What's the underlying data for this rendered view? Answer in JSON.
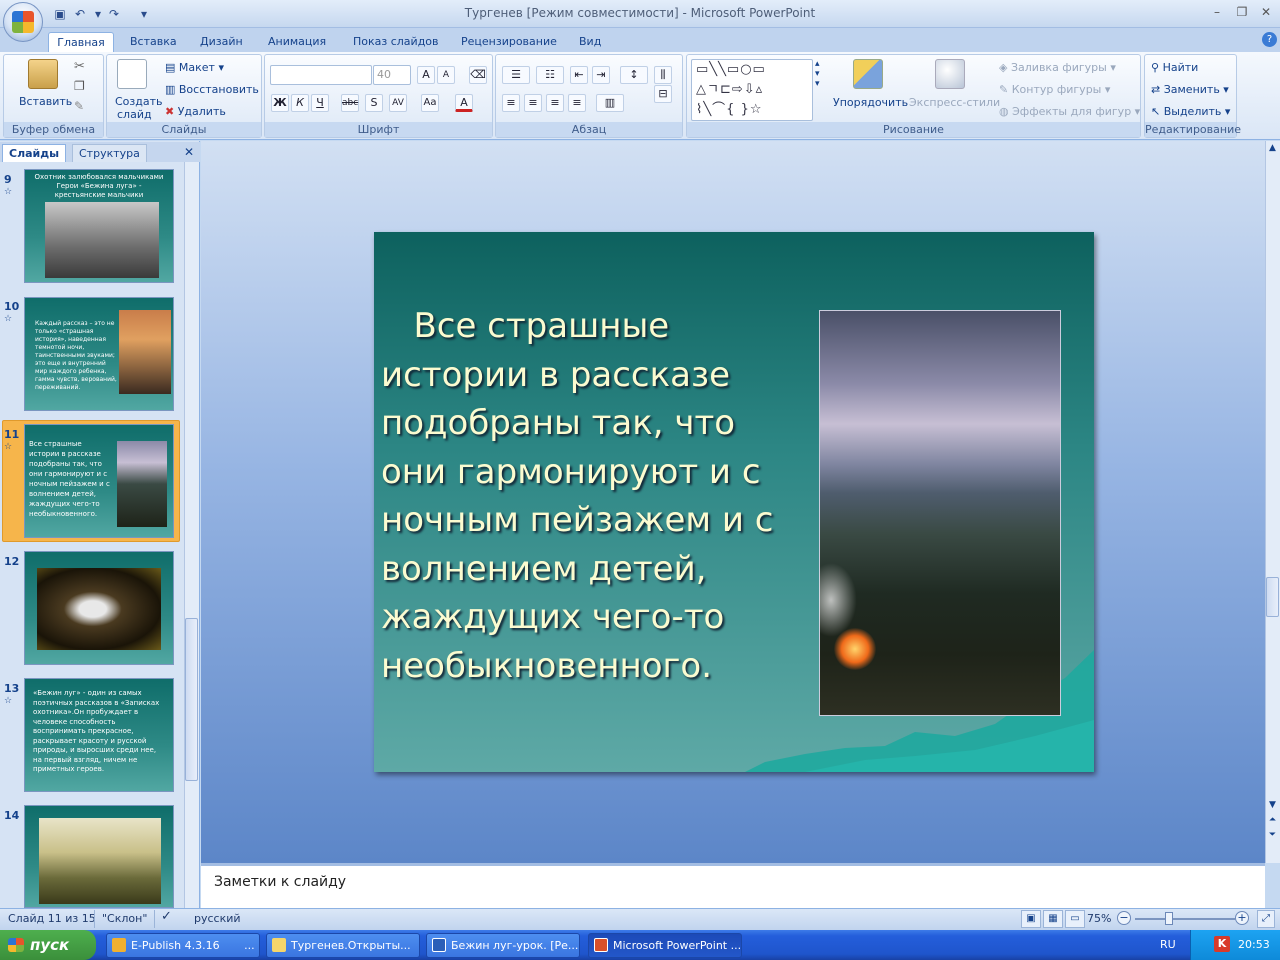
{
  "window": {
    "title": "Тургенев [Режим совместимости] - Microsoft PowerPoint"
  },
  "ribbon": {
    "tabs": [
      "Главная",
      "Вставка",
      "Дизайн",
      "Анимация",
      "Показ слайдов",
      "Рецензирование",
      "Вид"
    ],
    "groups": {
      "clipboard": {
        "label": "Буфер обмена",
        "paste": "Вставить"
      },
      "slides": {
        "label": "Слайды",
        "new_slide_1": "Создать",
        "new_slide_2": "слайд",
        "layout": "Макет",
        "reset": "Восстановить",
        "delete": "Удалить"
      },
      "font": {
        "label": "Шрифт",
        "font_name": "",
        "font_size": "40"
      },
      "paragraph": {
        "label": "Абзац"
      },
      "drawing": {
        "label": "Рисование",
        "arrange": "Упорядочить",
        "quick_styles": "Экспресс-стили",
        "shape_fill": "Заливка фигуры",
        "shape_outline": "Контур фигуры",
        "shape_effects": "Эффекты для фигур"
      },
      "editing": {
        "label": "Редактирование",
        "find": "Найти",
        "replace": "Заменить",
        "select": "Выделить"
      }
    }
  },
  "panel": {
    "tab_slides": "Слайды",
    "tab_outline": "Структура",
    "slides": [
      {
        "num": "9",
        "text": "Охотник залюбовался мальчиками Герои «Бежина луга» - крестьянские мальчики"
      },
      {
        "num": "10",
        "text": "Каждый рассказ – это не только «страшная история», наведенная темнотой ночи, таинственными звуками; это еще и внутренний мир каждого ребенка, гамма чувств, верований, переживаний."
      },
      {
        "num": "11",
        "text": "Все страшные истории в рассказе подобраны так, что они гармонируют и с ночным пейзажем и с волнением детей, жаждущих чего-то необыкновенного."
      },
      {
        "num": "12",
        "text": ""
      },
      {
        "num": "13",
        "text": "«Бежин луг» - один из самых поэтичных рассказов в «Записках охотника».Он пробуждает в человеке способность воспринимать прекрасное, раскрывает красоту и русской природы, и выросших среди нее, на первый взгляд, ничем не приметных героев."
      },
      {
        "num": "14",
        "text": ""
      }
    ]
  },
  "slide": {
    "text": "Все страшные истории в рассказе подобраны так, что они гармонируют и с ночным пейзажем и с волнением детей, жаждущих чего-то необыкновенного."
  },
  "notes": {
    "placeholder": "Заметки к слайду"
  },
  "status": {
    "slide_of": "Слайд 11 из 15",
    "theme": "\"Склон\"",
    "language": "русский",
    "zoom": "75%"
  },
  "taskbar": {
    "start": "пуск",
    "tasks": [
      "E-Publish 4.3.16",
      "...",
      "Тургенев.Открыты...",
      "Бежин луг-урок. [Ре...",
      "Microsoft PowerPoint ..."
    ],
    "lang": "RU",
    "clock": "20:53"
  },
  "colors": {
    "slide_bg": "#2c8684",
    "slide_text": "#fbfbd0",
    "ribbon_bg": "#dae6f6",
    "taskbar": "#245edb"
  }
}
